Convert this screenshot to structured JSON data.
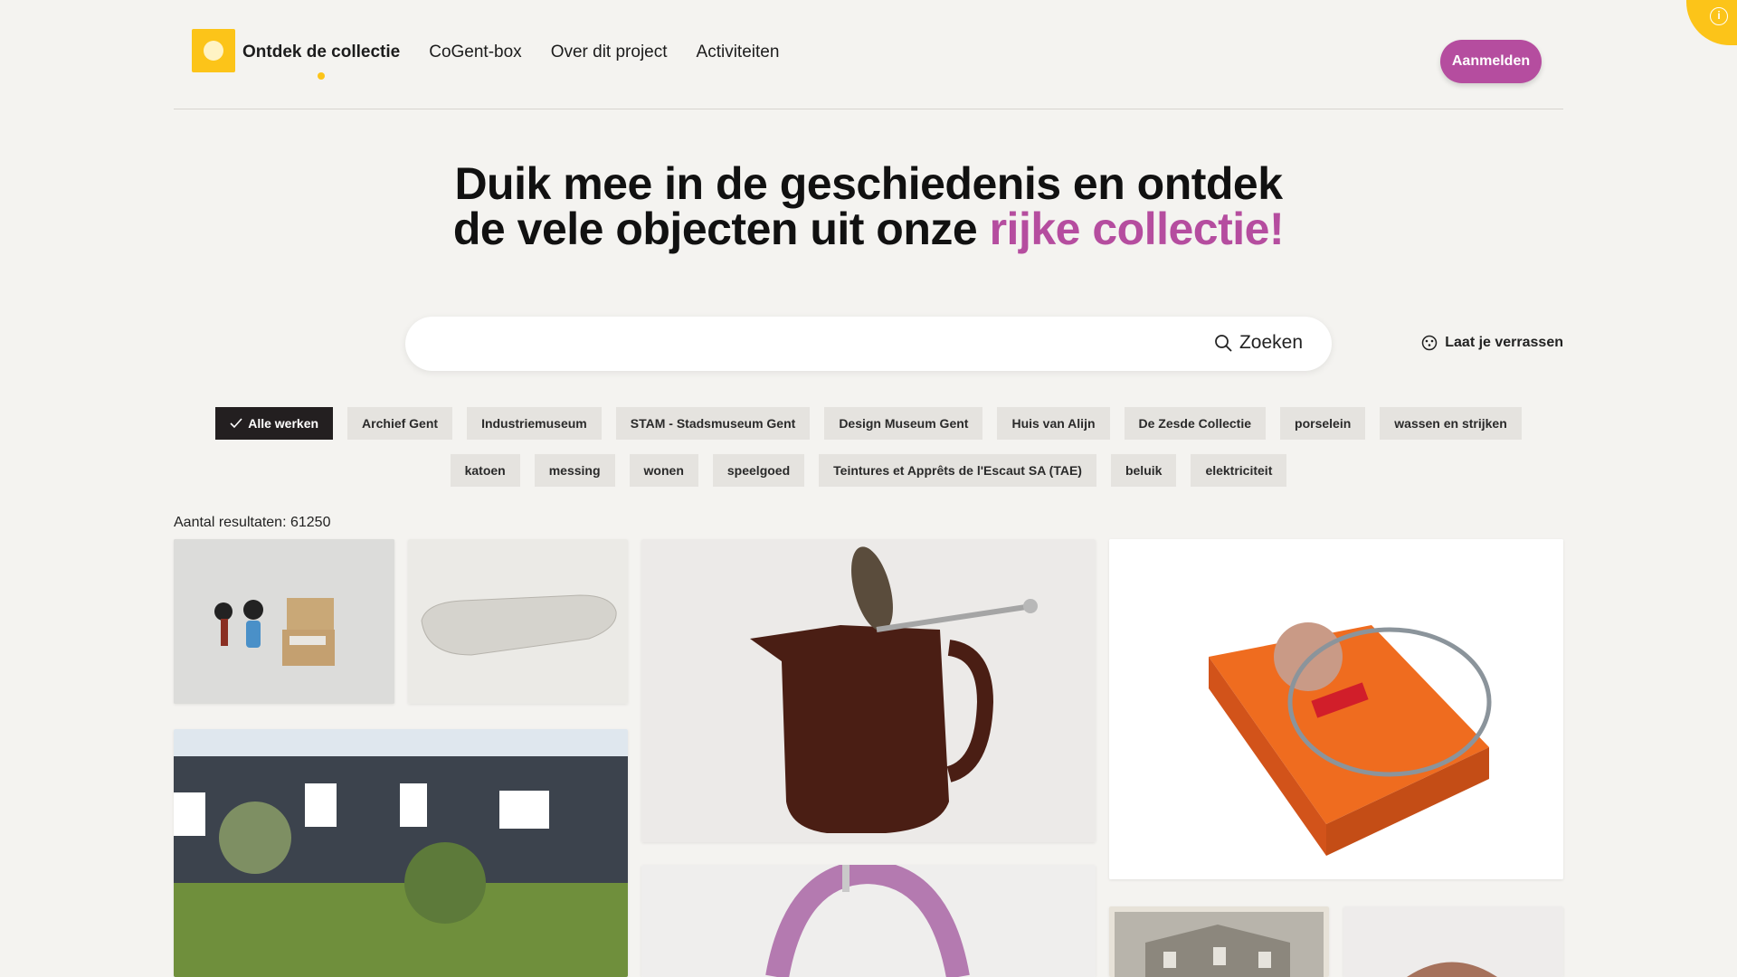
{
  "nav": {
    "brand": "Ontdek de collectie",
    "items": [
      {
        "label": "CoGent-box"
      },
      {
        "label": "Over dit project"
      },
      {
        "label": "Activiteiten"
      }
    ],
    "login_label": "Aanmelden"
  },
  "hero": {
    "line1": "Duik mee in de geschiedenis en ontdek",
    "line2_plain": "de vele objecten uit onze ",
    "line2_accent": "rijke collectie!"
  },
  "search": {
    "placeholder": "",
    "button_label": "Zoeken",
    "surprise_label": "Laat je verrassen"
  },
  "filters": {
    "row1": [
      "Alle werken",
      "Archief Gent",
      "Industriemuseum",
      "STAM - Stadsmuseum Gent",
      "Design Museum Gent",
      "Huis van Alijn",
      "De Zesde Collectie",
      "porselein",
      "wassen en strijken"
    ],
    "row2": [
      "katoen",
      "messing",
      "wonen",
      "speelgoed",
      "Teintures et Apprêts de l'Escaut SA (TAE)",
      "beluik",
      "elektriciteit"
    ]
  },
  "results": {
    "count_text": "Aantal resultaten: 61250"
  },
  "colors": {
    "accent": "#b54d9f",
    "brand_yellow": "#fcc419",
    "background": "#f4f3f0",
    "chip": "#e5e3df",
    "chip_active": "#231f20"
  },
  "icons": {
    "search": "search-icon",
    "surprise": "dice-icon",
    "check": "check-icon",
    "info": "info-icon"
  }
}
